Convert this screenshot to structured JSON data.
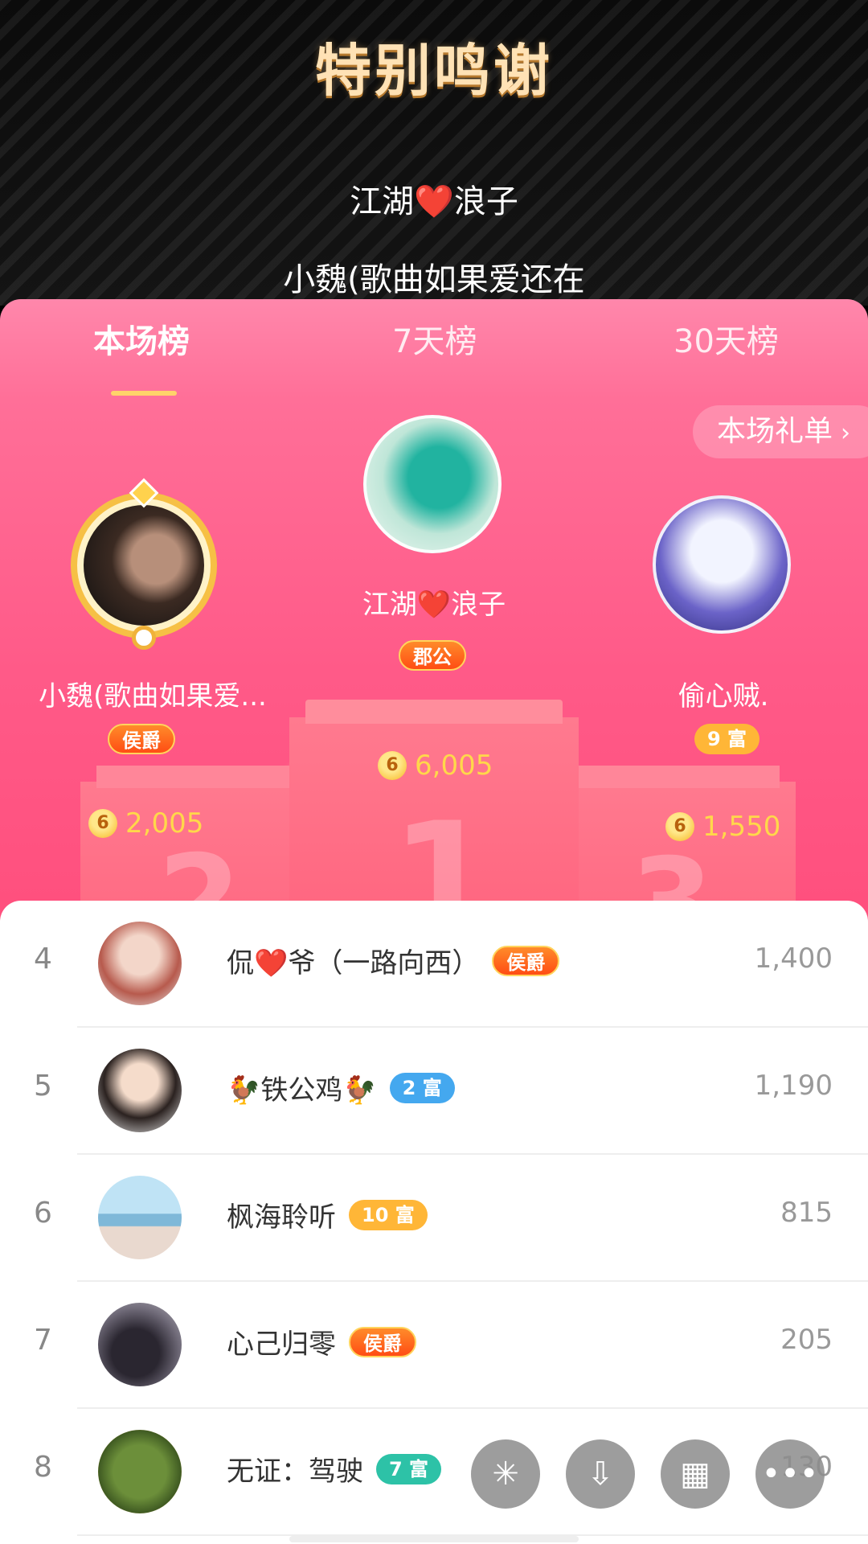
{
  "banner": {
    "title": "特别鸣谢",
    "line1": "江湖❤️浪子",
    "line2": "小魏(歌曲如果爱还在"
  },
  "tabs": [
    {
      "label": "本场榜",
      "active": true
    },
    {
      "label": "7天榜",
      "active": false
    },
    {
      "label": "30天榜",
      "active": false
    }
  ],
  "gift_list_button": {
    "label": "本场礼单",
    "chevron": "›"
  },
  "podium": {
    "first": {
      "name": "江湖❤️浪子",
      "badge": "郡公",
      "coins": "6,005",
      "rank_numeral": "1"
    },
    "second": {
      "name": "小魏(歌曲如果爱...",
      "badge": "侯爵",
      "coins": "2,005",
      "rank_numeral": "2"
    },
    "third": {
      "name": "偷心贼.",
      "badge": "9 富",
      "coins": "1,550",
      "rank_numeral": "3"
    }
  },
  "coin_symbol": "6",
  "list": [
    {
      "rank": "4",
      "name": "侃❤️爷（一路向西）",
      "badge": "侯爵",
      "badge_type": "noble",
      "value": "1,400"
    },
    {
      "rank": "5",
      "name": "🐓铁公鸡🐓",
      "badge": "2 富",
      "badge_type": "rich-blue",
      "value": "1,190"
    },
    {
      "rank": "6",
      "name": "枫海聆听",
      "badge": "10 富",
      "badge_type": "rich-yellow",
      "value": "815"
    },
    {
      "rank": "7",
      "name": "心己归零",
      "badge": "侯爵",
      "badge_type": "noble",
      "value": "205"
    },
    {
      "rank": "8",
      "name": "无证：驾驶",
      "badge": "7 富",
      "badge_type": "rich-teal",
      "value": "130"
    }
  ],
  "fabs": [
    {
      "icon": "share-icon",
      "glyph": "✳"
    },
    {
      "icon": "download-icon",
      "glyph": "⇩"
    },
    {
      "icon": "grid-icon",
      "glyph": "▦"
    },
    {
      "icon": "more-icon",
      "glyph": "•••"
    }
  ],
  "colors": {
    "accent_pink": "#ff4a78",
    "gold": "#ffd84a",
    "tab_underline": "#ffd36a"
  }
}
